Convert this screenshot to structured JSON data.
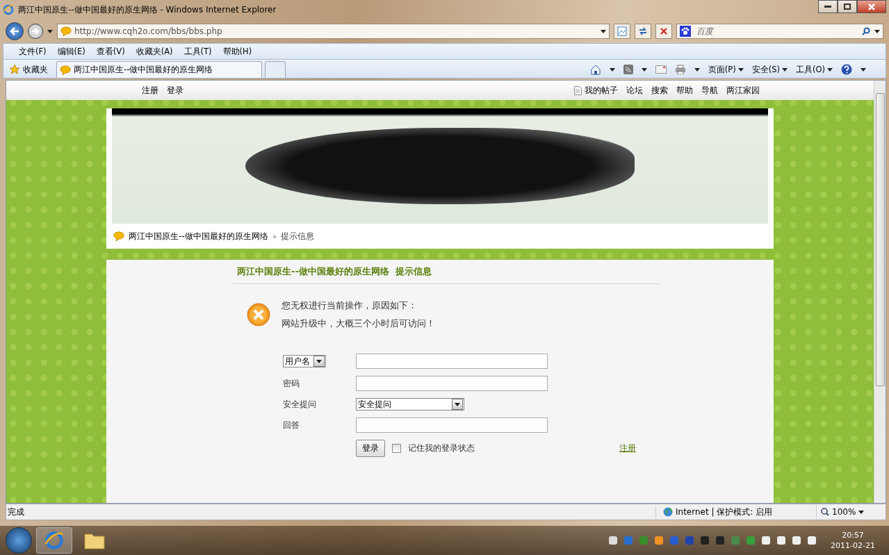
{
  "window": {
    "title": "两江中国原生--做中国最好的原生网络 - Windows Internet Explorer"
  },
  "address": {
    "url": "http://www.cqh2o.com/bbs/bbs.php"
  },
  "search": {
    "placeholder": "百度"
  },
  "menu": [
    "文件(F)",
    "编辑(E)",
    "查看(V)",
    "收藏夹(A)",
    "工具(T)",
    "帮助(H)"
  ],
  "favorites": {
    "label": "收藏夹"
  },
  "tabs": [
    {
      "label": "两江中国原生--做中国最好的原生网络",
      "selected": true
    }
  ],
  "commands": [
    "页面(P)",
    "安全(S)",
    "工具(O)"
  ],
  "page": {
    "top_left": [
      "注册",
      "登录"
    ],
    "top_right": [
      {
        "label": "我的帖子",
        "kind": "icon"
      },
      {
        "label": "论坛",
        "kind": "plain"
      },
      {
        "label": "搜索",
        "kind": "plain"
      },
      {
        "label": "帮助",
        "kind": "plain"
      },
      {
        "label": "导航",
        "kind": "plain"
      },
      {
        "label": "两江家园",
        "kind": "plain"
      }
    ],
    "breadcrumb": {
      "site": "两江中国原生--做中国最好的原生网络",
      "separator": "»",
      "current": "提示信息"
    },
    "notice_title": "两江中国原生--做中国最好的原生网络  提示信息",
    "message": [
      "您无权进行当前操作，原因如下：",
      "网站升级中，大概三个小时后可访问！"
    ],
    "form": {
      "rows": [
        {
          "kind": "select",
          "label": "用户名",
          "value": ""
        },
        {
          "kind": "text",
          "label": "密码",
          "value": ""
        },
        {
          "kind": "question",
          "label": "安全提问",
          "value": "安全提问"
        },
        {
          "kind": "text",
          "label": "回答",
          "value": ""
        }
      ],
      "login": "登录",
      "remember": {
        "label": "记住我的登录状态",
        "checked": false
      },
      "register": "注册"
    }
  },
  "status_bar": {
    "text": "完成",
    "zone": "Internet | 保护模式: 启用",
    "zoom": "100%"
  },
  "taskbar": {
    "time": "20:57",
    "date": "2011-02-21"
  }
}
